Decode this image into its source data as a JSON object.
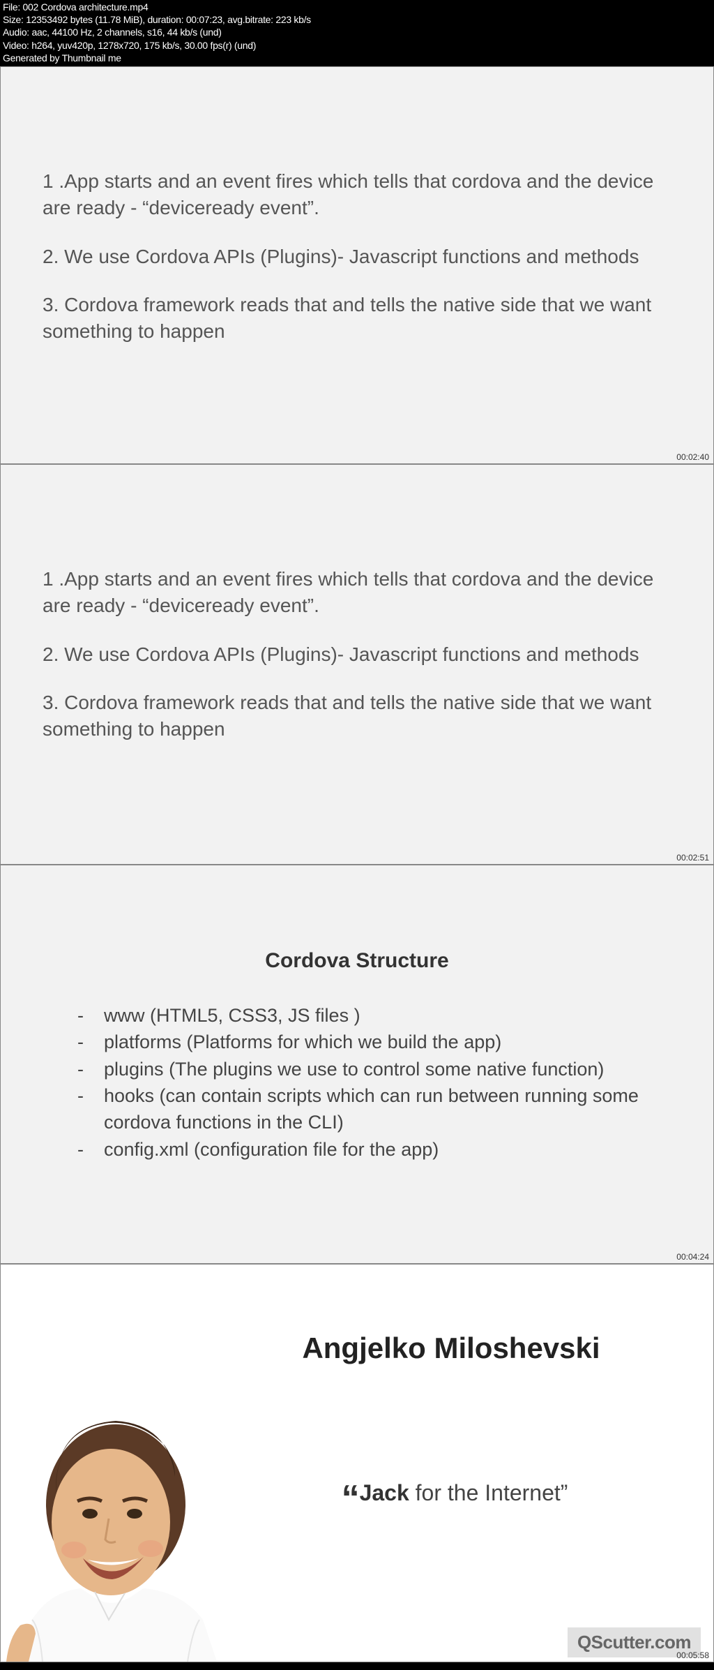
{
  "metadata": {
    "file": "File: 002 Cordova architecture.mp4",
    "size": "Size: 12353492 bytes (11.78 MiB), duration: 00:07:23, avg.bitrate: 223 kb/s",
    "audio": "Audio: aac, 44100 Hz, 2 channels, s16, 44 kb/s (und)",
    "video": "Video: h264, yuv420p, 1278x720, 175 kb/s, 30.00 fps(r) (und)",
    "generated": "Generated by Thumbnail me"
  },
  "frame1": {
    "p1": "1 .App starts and an event fires which tells that cordova and the device are ready - “deviceready event”.",
    "p2": "2. We use Cordova APIs (Plugins)- Javascript functions and methods",
    "p3": "3. Cordova framework reads that and tells the native side that we want something to happen",
    "ts": "00:02:40"
  },
  "frame2": {
    "p1": "1 .App starts and an event fires which tells that cordova and the device are ready - “deviceready event”.",
    "p2": "2. We use Cordova APIs (Plugins)- Javascript functions and methods",
    "p3": "3. Cordova framework reads that and tells the native side that we want something to happen",
    "ts": "00:02:51"
  },
  "frame3": {
    "title": "Cordova Structure",
    "items": [
      "www (HTML5, CSS3, JS files )",
      "platforms (Platforms for which we build the app)",
      "plugins (The plugins we use to control some native function)",
      "hooks (can contain scripts which can run between running some cordova functions in the CLI)",
      "config.xml (configuration file for the app)"
    ],
    "ts": "00:04:24"
  },
  "frame4": {
    "name": "Angjelko Miloshevski",
    "quote_name": "Jack",
    "quote_rest": " for the Internet”",
    "watermark": "QScutter.com",
    "ts": "00:05:58"
  }
}
